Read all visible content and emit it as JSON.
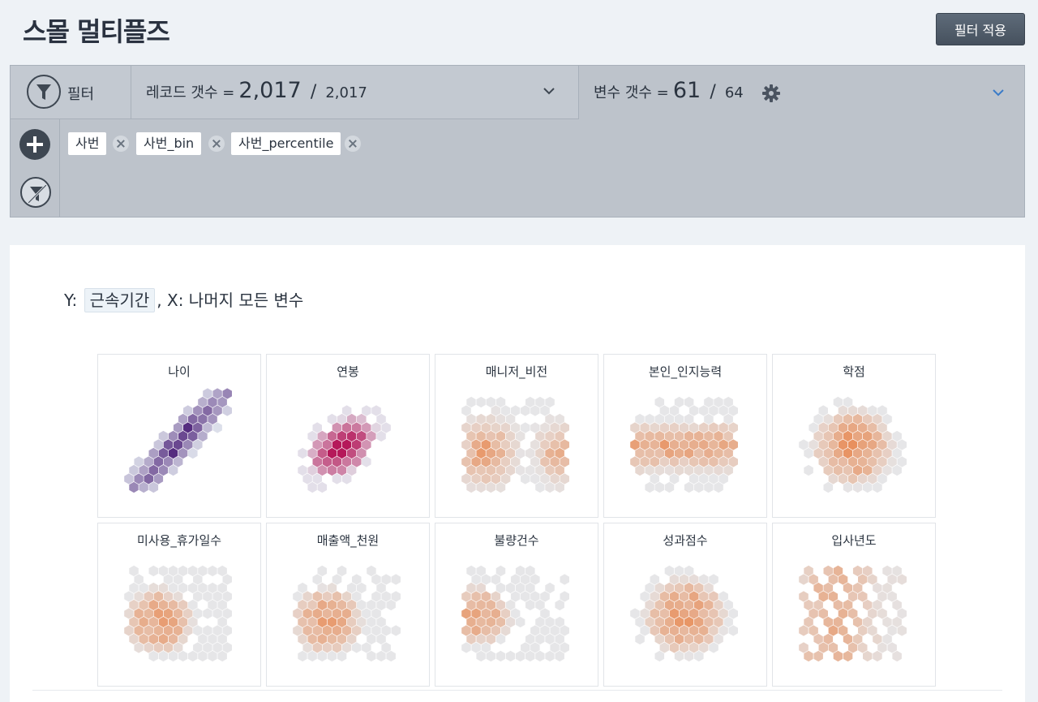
{
  "page": {
    "title": "스몰 멀티플즈",
    "apply_button": "필터 적용"
  },
  "filter_bar": {
    "label": "필터",
    "records": {
      "label": "레코드 갯수 =",
      "filtered": "2,017",
      "separator": "/",
      "total": "2,017"
    },
    "variables": {
      "label": "변수 갯수 =",
      "selected": "61",
      "separator": "/",
      "total": "64"
    },
    "icons": {
      "filter": "funnel-icon",
      "add": "plus-icon",
      "clear": "funnel-off-icon",
      "settings": "gear-icon",
      "records_dropdown": "chevron-down-icon",
      "variables_dropdown": "chevron-down-icon",
      "remove_chip": "close-icon"
    },
    "chips": [
      "사번",
      "사번_bin",
      "사번_percentile"
    ]
  },
  "axis_description": {
    "prefix": "Y:",
    "y_variable": "근속기간",
    "suffix": ", X: 나머지 모든 변수"
  },
  "colors": {
    "purple": "#3f0f6e",
    "magenta": "#b5195a",
    "orange": "#e8874f",
    "base": "#e6ecf2"
  },
  "chart_data": [
    {
      "type": "heatmap",
      "title": "나이",
      "colormap": "purple",
      "pattern": "diagonal"
    },
    {
      "type": "heatmap",
      "title": "연봉",
      "colormap": "magenta",
      "pattern": "blob"
    },
    {
      "type": "heatmap",
      "title": "매니저_비전",
      "colormap": "orange",
      "pattern": "wide-split"
    },
    {
      "type": "heatmap",
      "title": "본인_인지능력",
      "colormap": "orange",
      "pattern": "wide-band"
    },
    {
      "type": "heatmap",
      "title": "학점",
      "colormap": "orange",
      "pattern": "center"
    },
    {
      "type": "heatmap",
      "title": "미사용_휴가일수",
      "colormap": "orange",
      "pattern": "left-blob"
    },
    {
      "type": "heatmap",
      "title": "매출액_천원",
      "colormap": "orange",
      "pattern": "left-blob"
    },
    {
      "type": "heatmap",
      "title": "불량건수",
      "colormap": "orange",
      "pattern": "left-edge"
    },
    {
      "type": "heatmap",
      "title": "성과점수",
      "colormap": "orange",
      "pattern": "center"
    },
    {
      "type": "heatmap",
      "title": "입사년도",
      "colormap": "orange",
      "pattern": "lattice"
    }
  ]
}
